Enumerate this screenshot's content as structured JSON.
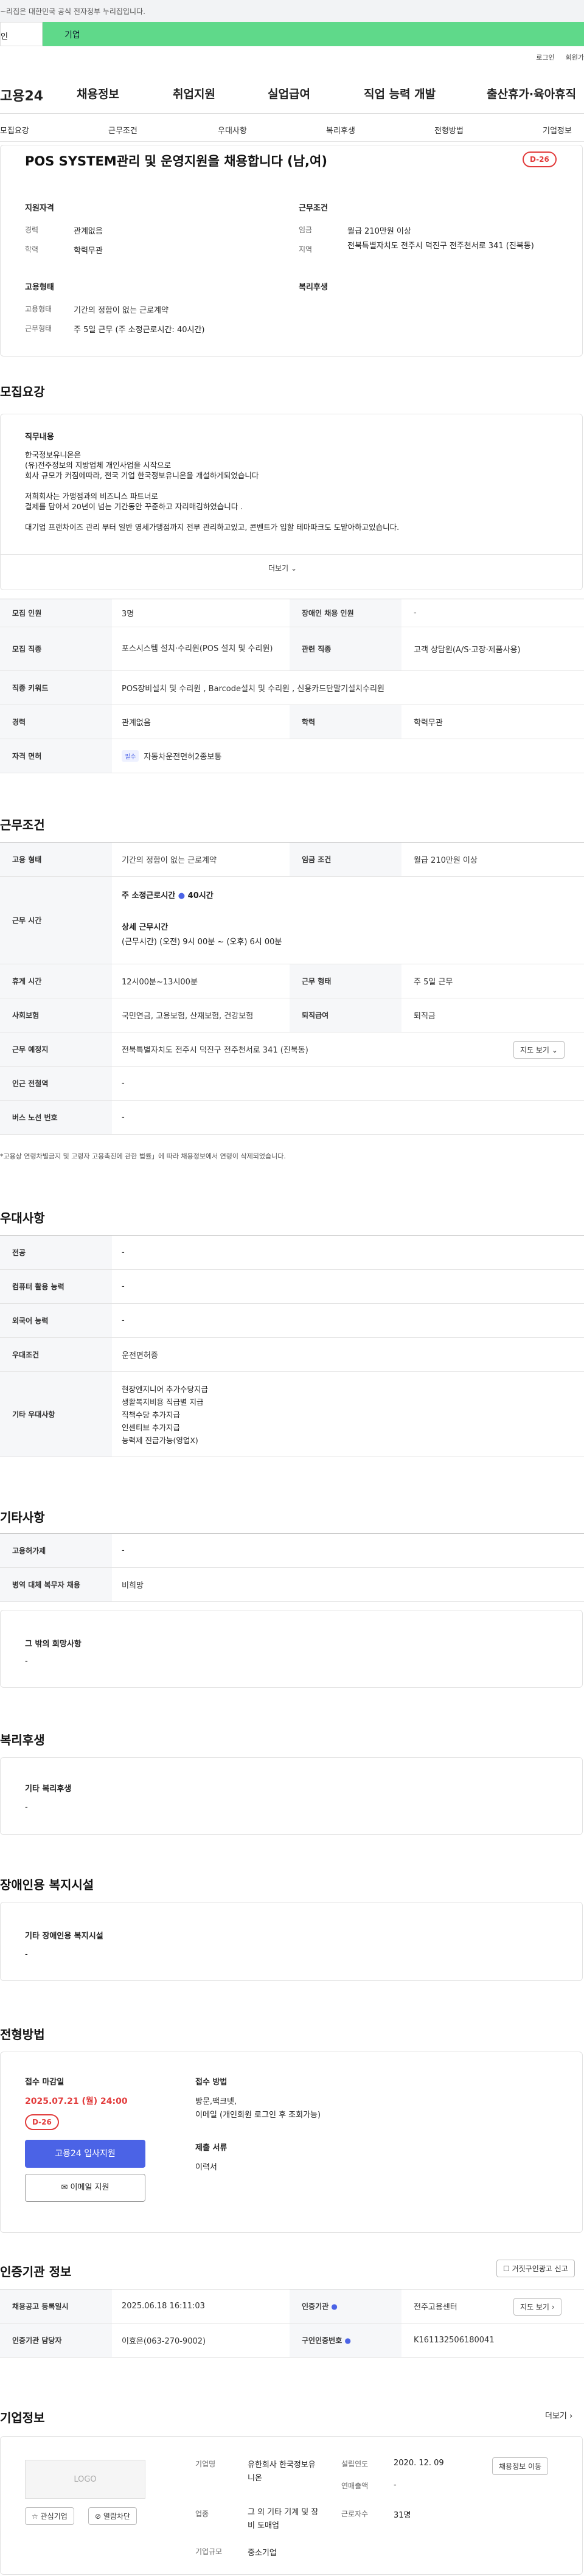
{
  "notice": {
    "text": "~리집은 대한민국 공식 전자정부 누리집입니다."
  },
  "site_tabs": {
    "personal": "인",
    "business": "기업"
  },
  "util": {
    "login": "로그인",
    "join": "회원가"
  },
  "header": {
    "logo": "고용24",
    "menu": [
      "채용정보",
      "취업지원",
      "실업급여",
      "직업 능력 개발",
      "출산휴가·육아휴직"
    ]
  },
  "subnav": [
    "모집요강",
    "근무조건",
    "우대사항",
    "복리후생",
    "전형방법",
    "기업정보"
  ],
  "job": {
    "title": "POS SYSTEM관리 및 운영지원을 채용합니다 (남,여)",
    "dday": "D-26",
    "qualification_title": "지원자격",
    "work_title": "근무조건",
    "career_label": "경력",
    "career": "관계없음",
    "edu_label": "학력",
    "edu": "학력무관",
    "wage_label": "임금",
    "wage": "월급 210만원 이상",
    "area_label": "지역",
    "area": "전북특별자치도 전주시 덕진구 전주천서로 341 (진북동)",
    "employ_title": "고용형태",
    "welfare_title": "복리후생",
    "employ_type_label": "고용형태",
    "employ_type": "기간의 정함이 없는 근로계약",
    "work_form_label": "근무형태",
    "work_form": "주 5일 근무 (주 소정근로시간: 40시간)"
  },
  "recruit": {
    "title": "모집요강",
    "duty_title": "직무내용",
    "desc": [
      "한국정보유니온은",
      "(유)전주정보의 지방업체 개인사업을 시작으로",
      "회사 규모가 커짐에따라, 전국 기업 한국정보유니온을 개설하게되었습니다",
      "",
      "저희회사는 가맹점과의 비즈니스 파트너로",
      "결제를 담아서 20년이 넘는 기간동안 꾸준하고 자리매김하였습니다 .",
      "",
      "대기업 프랜차이즈 관리 부터 일반 영세가맹점까지 전부 관리하고있고, 콘벤트가 입할 테마파크도 도맡아하고있습니다."
    ],
    "more": "더보기",
    "rows": [
      {
        "th": "모집 인원",
        "td": "3명",
        "th2": "장애인 채용 인원",
        "td2": "-"
      },
      {
        "th": "모집 직종",
        "td": "포스시스템 설치·수리원(POS 설치 및 수리원)",
        "th2": "관련 직종",
        "td2": "고객 상담원(A/S·고장·제품사용)"
      },
      {
        "th": "직종 키워드",
        "td": "POS장비설치 및 수리원 , Barcode설치 및 수리원 , 신용카드단말기설치수리원"
      },
      {
        "th": "경력",
        "td": "관계없음",
        "th2": "학력",
        "td2": "학력무관"
      },
      {
        "th": "자격 면허",
        "pill": "필수",
        "td": "자동차운전면허2종보통"
      }
    ]
  },
  "conditions": {
    "title": "근무조건",
    "employ_th": "고용 형태",
    "employ_td": "기간의 정함이 없는 근로계약",
    "wage_th": "임금 조건",
    "wage_td": "월급 210만원 이상",
    "hours_th": "근무 시간",
    "weekly": "주 소정근로시간",
    "weekly_val": "40시간",
    "detail_title": "상세 근무시간",
    "detail": "(근무시간) (오전) 9시 00분 ~ (오후) 6시 00분",
    "rest_th": "휴게 시간",
    "rest_td": "12시00분~13시00분",
    "form_th": "근무 형태",
    "form_td": "주 5일 근무",
    "ins_th": "사회보험",
    "ins_td": "국민연금, 고용보험, 산재보험, 건강보험",
    "sev_th": "퇴직급여",
    "sev_td": "퇴직금",
    "place_th": "근무 예정지",
    "place_td": "전북특별자치도 전주시 덕진구 전주천서로 341 (진북동)",
    "map_btn": "지도 보기",
    "subway_th": "인근 전철역",
    "subway_td": "-",
    "bus_th": "버스 노선 번호",
    "bus_td": "-",
    "note": "*고용상 연령차별금지 및 고령자 고용촉진에 관한 법률」에 따라 채용정보에서 연령이 삭제되었습니다."
  },
  "prefer": {
    "title": "우대사항",
    "rows": [
      {
        "th": "전공",
        "td": "-"
      },
      {
        "th": "컴퓨터 활용 능력",
        "td": "-"
      },
      {
        "th": "외국어 능력",
        "td": "-"
      },
      {
        "th": "우대조건",
        "td": "운전면허증"
      }
    ],
    "etc_th": "기타 우대사항",
    "etc": [
      "현장엔지니어 추가수당지급",
      "생활복지비용 직급별 지급",
      "직책수당 추가지급",
      "인센티브 추가지급",
      "능력제 진급가능(영업X)"
    ]
  },
  "other": {
    "title": "기타사항",
    "rows": [
      {
        "th": "고용허가제",
        "td": "-"
      },
      {
        "th": "병역 대체 복무자 채용",
        "td": "비희망"
      }
    ],
    "wish_title": "그 밖의 희망사항",
    "wish": "-"
  },
  "welfare": {
    "title": "복리후생",
    "box_title": "기타 복리후생",
    "box_val": "-"
  },
  "disabled": {
    "title": "장애인용 복지시설",
    "box_title": "기타 장애인용 복지시설",
    "box_val": "-"
  },
  "screening": {
    "title": "전형방법",
    "deadline_label": "접수 마감일",
    "deadline": "2025.07.21 (월) 24:00",
    "dday": "D-26",
    "apply_btn": "고용24 입사지원",
    "email_btn": "이메일 지원",
    "method_label": "접수 방법",
    "method": "방문,팩크넷,",
    "method2": "이메일 (개인회원 로그인 후 조회가능)",
    "docs_label": "제출 서류",
    "docs": "이력서"
  },
  "cert": {
    "title": "인증기관 정보",
    "report_btn": "거짓구인광고 신고",
    "reg_th": "채용공고 등록일시",
    "reg_td": "2025.06.18 16:11:03",
    "org_th": "인증기관",
    "org_td": "전주고용센터",
    "map_btn": "지도 보기",
    "mgr_th": "인증기관 담당자",
    "mgr_td": "이효은(063-270-9002)",
    "no_th": "구인인증번호",
    "no_td": "K161132506180041"
  },
  "company": {
    "title": "기업정보",
    "more": "더보기",
    "logo": "LOGO",
    "fav": "관심기업",
    "block": "열람차단",
    "name_label": "기업명",
    "name": "유한회사 한국정보유니온",
    "est_label": "설립연도",
    "est": "2020. 12. 09",
    "jobinfo_btn": "채용정보 이동",
    "sales_label": "연매출액",
    "sales": "-",
    "industry_label": "업종",
    "industry": "그 외 기타 기계 및 장비 도매업",
    "emp_label": "근로자수",
    "emp": "31명",
    "scale_label": "기업규모",
    "scale": "중소기업"
  },
  "colors": {
    "accent_green": "#5fd98a",
    "brand_blue": "#4b63e6",
    "dday_red": "#e23c3c"
  }
}
